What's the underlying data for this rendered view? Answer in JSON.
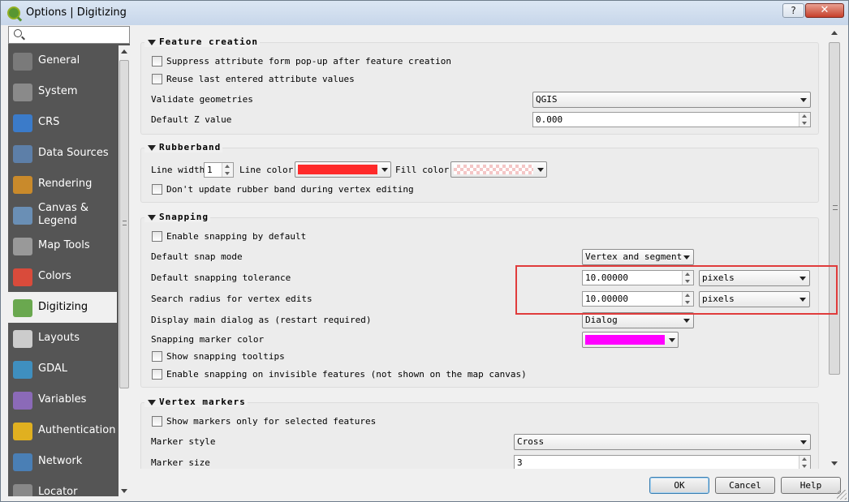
{
  "window": {
    "title": "Options | Digitizing",
    "help_label": "?",
    "close_label": "✕"
  },
  "search": {
    "placeholder": ""
  },
  "sidebar": {
    "items": [
      {
        "label": "General",
        "icon": "wrench-icon",
        "color": "#7a7a7a"
      },
      {
        "label": "System",
        "icon": "gears-icon",
        "color": "#8a8a8a"
      },
      {
        "label": "CRS",
        "icon": "globe-icon",
        "color": "#3b7bc9"
      },
      {
        "label": "Data Sources",
        "icon": "table-icon",
        "color": "#5d7fa8"
      },
      {
        "label": "Rendering",
        "icon": "paintbrush-icon",
        "color": "#c98a2b"
      },
      {
        "label": "Canvas & Legend",
        "icon": "canvas-icon",
        "color": "#6a8fb5"
      },
      {
        "label": "Map Tools",
        "icon": "map-tools-icon",
        "color": "#999999"
      },
      {
        "label": "Colors",
        "icon": "palette-icon",
        "color": "#d94b3b"
      },
      {
        "label": "Digitizing",
        "icon": "digitizing-icon",
        "color": "#6aa84f"
      },
      {
        "label": "Layouts",
        "icon": "layout-icon",
        "color": "#cccccc"
      },
      {
        "label": "GDAL",
        "icon": "gdal-icon",
        "color": "#3f8fbf"
      },
      {
        "label": "Variables",
        "icon": "epsilon-icon",
        "color": "#8b6ab8"
      },
      {
        "label": "Authentication",
        "icon": "lock-icon",
        "color": "#e0b020"
      },
      {
        "label": "Network",
        "icon": "network-icon",
        "color": "#4a7fb5"
      },
      {
        "label": "Locator",
        "icon": "locator-icon",
        "color": "#888888"
      }
    ],
    "selected": "Digitizing"
  },
  "feature_creation": {
    "title": "Feature creation",
    "suppress_form": "Suppress attribute form pop-up after feature creation",
    "reuse_values": "Reuse last entered attribute values",
    "validate_label": "Validate geometries",
    "validate_value": "QGIS",
    "default_z_label": "Default Z value",
    "default_z_value": "0.000"
  },
  "rubberband": {
    "title": "Rubberband",
    "line_width_label": "Line width",
    "line_width_value": "1",
    "line_color_label": "Line color",
    "line_color": "#ff2a2a",
    "fill_color_label": "Fill color",
    "fill_color": "#f4c6c6",
    "dont_update": "Don't update rubber band during vertex editing"
  },
  "snapping": {
    "title": "Snapping",
    "enable_default": "Enable snapping by default",
    "snap_mode_label": "Default snap mode",
    "snap_mode_value": "Vertex and segment",
    "tolerance_label": "Default snapping tolerance",
    "tolerance_value": "10.00000",
    "tolerance_unit": "pixels",
    "search_radius_label": "Search radius for vertex edits",
    "search_radius_value": "10.00000",
    "search_radius_unit": "pixels",
    "display_dialog_label": "Display main dialog as (restart required)",
    "display_dialog_value": "Dialog",
    "marker_color_label": "Snapping marker color",
    "marker_color": "#ff00ff",
    "show_tooltips": "Show snapping tooltips",
    "invisible_features": "Enable snapping on invisible features (not shown on the map canvas)"
  },
  "vertex_markers": {
    "title": "Vertex markers",
    "selected_only": "Show markers only for selected features",
    "marker_style_label": "Marker style",
    "marker_style_value": "Cross",
    "marker_size_label": "Marker size",
    "marker_size_value": "3"
  },
  "buttons": {
    "ok": "OK",
    "cancel": "Cancel",
    "help": "Help"
  },
  "colors": {
    "highlight": "#e03c3c",
    "sidebar_bg": "#555555"
  }
}
